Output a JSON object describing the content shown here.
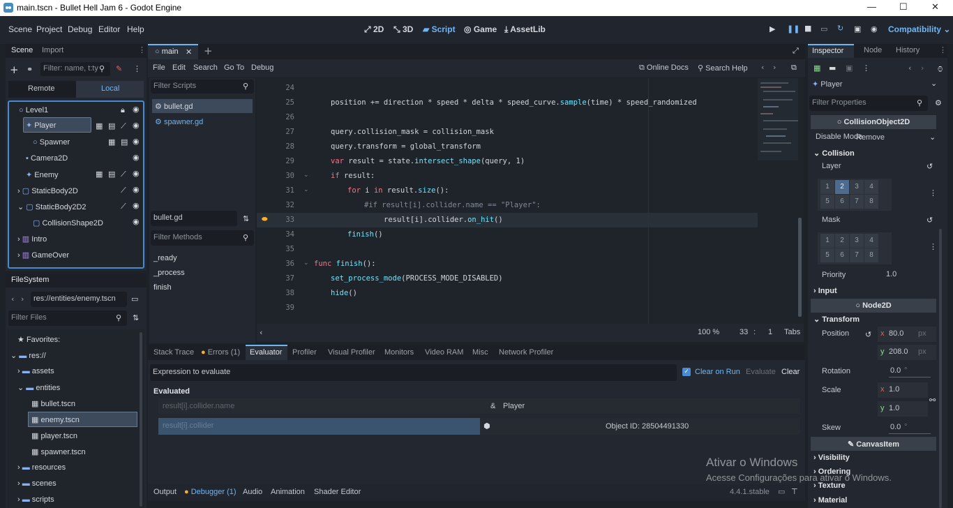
{
  "window": {
    "title": "main.tscn - Bullet Hell Jam 6 - Godot Engine",
    "minimize": "—",
    "maximize": "☐",
    "close": "✕"
  },
  "menu": [
    "Scene",
    "Project",
    "Debug",
    "Editor",
    "Help"
  ],
  "workspaces": [
    "2D",
    "3D",
    "Script",
    "Game",
    "AssetLib"
  ],
  "workspace_active": "Script",
  "renderer": "Compatibility",
  "scene_dock": {
    "tabs": [
      "Scene",
      "Import"
    ],
    "filter_placeholder": "Filter: name, t:ty",
    "remote": "Remote",
    "local": "Local",
    "nodes": [
      "Level1",
      "Player",
      "Spawner",
      "Camera2D",
      "Enemy",
      "StaticBody2D",
      "StaticBody2D2",
      "CollisionShape2D",
      "Intro",
      "GameOver"
    ]
  },
  "filesystem": {
    "tab": "FileSystem",
    "path": "res://entities/enemy.tscn",
    "filter_placeholder": "Filter Files",
    "items": [
      "Favorites:",
      "res://",
      "assets",
      "entities",
      "bullet.tscn",
      "enemy.tscn",
      "player.tscn",
      "spawner.tscn",
      "resources",
      "scenes",
      "scripts"
    ]
  },
  "script_editor": {
    "tab": "main",
    "menu": [
      "File",
      "Edit",
      "Search",
      "Go To",
      "Debug"
    ],
    "online_docs": "Online Docs",
    "search_help": "Search Help",
    "filter_scripts": "Filter Scripts",
    "scripts": [
      "bullet.gd",
      "spawner.gd"
    ],
    "current_script": "bullet.gd",
    "filter_methods": "Filter Methods",
    "methods": [
      "_ready",
      "_process",
      "finish"
    ],
    "line_numbers": [
      "24",
      "25",
      "26",
      "27",
      "28",
      "29",
      "30",
      "31",
      "32",
      "33",
      "34",
      "35",
      "36",
      "37",
      "38",
      "39"
    ],
    "zoom": "100 %",
    "line": "33",
    "col": "1",
    "indent": "Tabs"
  },
  "code": {
    "l25": "position += direction * speed * delta * speed_curve.",
    "l25_fn": "sample",
    "l25_rest": "(time) * speed_randomized",
    "l27": "query.collision_mask = collision_mask",
    "l28": "query.transform = global_transform",
    "l29_kw": "var",
    "l29a": " result = state.",
    "l29_fn": "intersect_shape",
    "l29b": "(query, 1)",
    "l30_kw": "if",
    "l30": " result:",
    "l31_kw": "for",
    "l31a": " i ",
    "l31_kw2": "in",
    "l31b": " result.",
    "l31_fn": "size",
    "l31c": "():",
    "l32": "#if result[i].collider.name == \"Player\":",
    "l33a": "result[i].collider.",
    "l33_fn": "on_hit",
    "l33b": "()",
    "l34_fn": "finish",
    "l34b": "()",
    "l36_kw": "func",
    "l36_fn": " finish",
    "l36b": "():",
    "l37_fn": "set_process_mode",
    "l37b": "(PROCESS_MODE_DISABLED)",
    "l38_fn": "hide",
    "l38b": "()"
  },
  "debugger": {
    "tabs": [
      "Stack Trace",
      "Errors (1)",
      "Evaluator",
      "Profiler",
      "Visual Profiler",
      "Monitors",
      "Video RAM",
      "Misc",
      "Network Profiler"
    ],
    "expression_placeholder": "Expression to evaluate",
    "clear_on_run": "Clear on Run",
    "evaluate": "Evaluate",
    "clear": "Clear",
    "evaluated": "Evaluated",
    "rows": [
      {
        "expr": "result[i].collider.name",
        "type": "&",
        "value": "Player"
      },
      {
        "expr": "result[i].collider",
        "type": "",
        "value": "Object ID: 28504491330"
      }
    ]
  },
  "bottom_bar": {
    "tabs": [
      "Output",
      "Debugger (1)",
      "Audio",
      "Animation",
      "Shader Editor"
    ],
    "version": "4.4.1.stable"
  },
  "inspector": {
    "tabs": [
      "Inspector",
      "Node",
      "History"
    ],
    "node": "Player",
    "filter_placeholder": "Filter Properties",
    "collision_object": "CollisionObject2D",
    "disable_mode_label": "Disable Mode",
    "disable_mode": "Remove",
    "collision": "Collision",
    "layer": "Layer",
    "mask": "Mask",
    "layer_cells": [
      "1",
      "2",
      "3",
      "4",
      "5",
      "6",
      "7",
      "8"
    ],
    "priority_label": "Priority",
    "priority": "1.0",
    "input": "Input",
    "node2d": "Node2D",
    "transform": "Transform",
    "position_label": "Position",
    "pos_x": "80.0",
    "pos_y": "208.0",
    "px": "px",
    "rotation_label": "Rotation",
    "rotation": "0.0",
    "scale_label": "Scale",
    "scale_x": "1.0",
    "scale_y": "1.0",
    "skew_label": "Skew",
    "skew": "0.0",
    "deg": "°",
    "canvas_item": "CanvasItem",
    "sub": [
      "Visibility",
      "Ordering",
      "Texture",
      "Material"
    ]
  },
  "watermark": {
    "line1": "Ativar o Windows",
    "line2": "Acesse Configurações para ativar o Windows."
  },
  "colors": {
    "accent": "#6fb6f5",
    "panel": "#232830",
    "bg": "#1d2229"
  }
}
